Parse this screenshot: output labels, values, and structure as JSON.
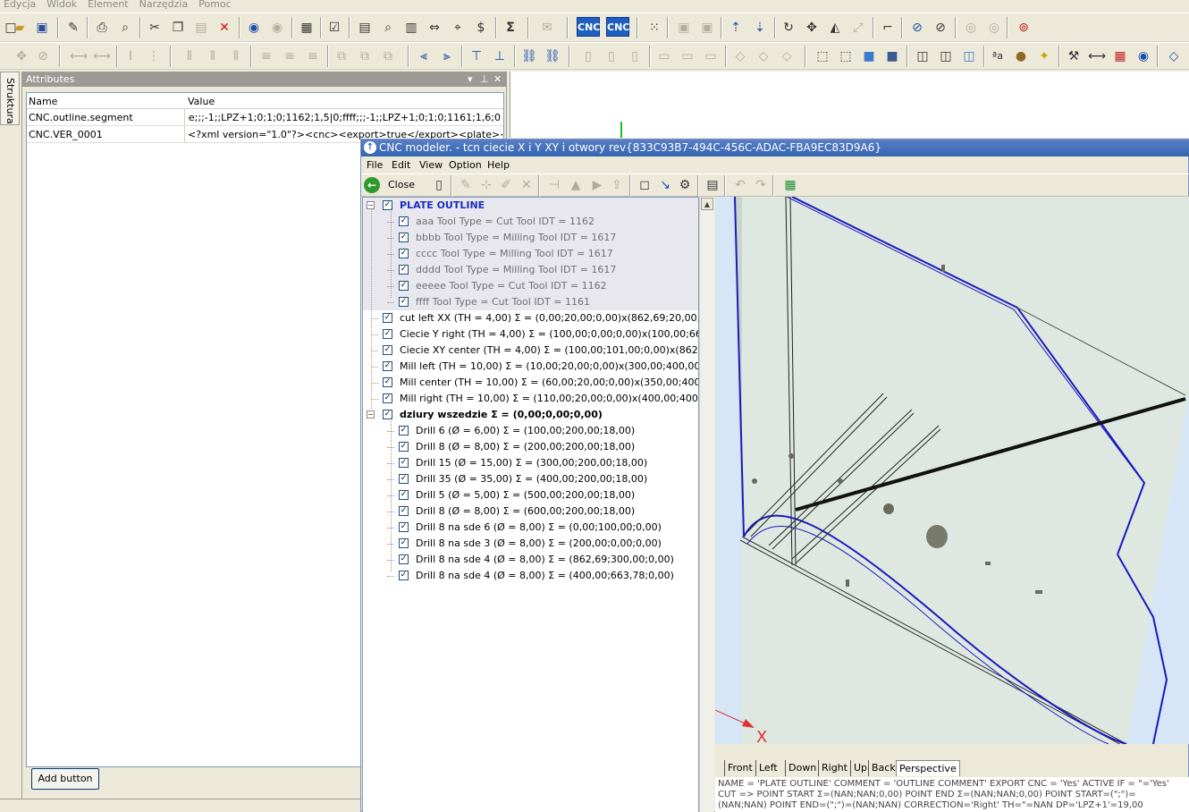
{
  "menu": [
    "Edycja",
    "Widok",
    "Element",
    "Narzędzia",
    "Pomoc"
  ],
  "toolbar": {
    "cnc1": "CNC",
    "cnc2": "CNC"
  },
  "sidetab": "Struktura",
  "attributes": {
    "title": "Attributes",
    "col_name": "Name",
    "col_value": "Value",
    "rows": [
      {
        "name": "CNC.outline.segment",
        "value": "0;eeeee;;;-1;;LPZ+1;0;1;0;1162;1,5|0;ffff;;;-1;;LPZ+1;0;1;0;1161;1,6|"
      },
      {
        "name": "CNC.VER_0001",
        "value": "<?xml version=\"1.0\"?><cnc><export>true</export><plate><width>86"
      }
    ],
    "add_button": "Add button"
  },
  "cnc": {
    "title": "CNC modeler. - tcn ciecie X i Y XY i otwory rev{833C93B7-494C-456C-ADAC-FBA9EC83D9A6}",
    "menu": [
      "File",
      "Edit",
      "View",
      "Option",
      "Help"
    ],
    "close": "Close",
    "tree": [
      {
        "label": "PLATE OUTLINE",
        "style": "blue",
        "level": 0,
        "exp": "−"
      },
      {
        "label": "aaa  Tool Type = Cut  Tool IDT = 1162",
        "style": "gray",
        "level": 1
      },
      {
        "label": "bbbb  Tool Type = Milling  Tool IDT = 1617",
        "style": "gray",
        "level": 1
      },
      {
        "label": "cccc  Tool Type = Milling  Tool IDT = 1617",
        "style": "gray",
        "level": 1
      },
      {
        "label": "dddd  Tool Type = Milling  Tool IDT = 1617",
        "style": "gray",
        "level": 1
      },
      {
        "label": "eeeee  Tool Type = Cut  Tool IDT = 1162",
        "style": "gray",
        "level": 1
      },
      {
        "label": "ffff  Tool Type = Cut  Tool IDT = 1161",
        "style": "gray",
        "level": 1
      },
      {
        "label": "cut left XX  (TH = 4,00)  Σ = (0,00;20,00;0,00)x(862,69;20,00;0,00)",
        "style": "",
        "level": 0
      },
      {
        "label": "Ciecie Y right  (TH = 4,00)  Σ = (100,00;0,00;0,00)x(100,00;663,78;0",
        "style": "",
        "level": 0
      },
      {
        "label": "Ciecie XY center  (TH = 4,00)  Σ = (100,00;101,00;0,00)x(862,69;66",
        "style": "",
        "level": 0
      },
      {
        "label": "Mill left  (TH = 10,00)  Σ = (10,00;20,00;0,00)x(300,00;400,00;0,00)",
        "style": "",
        "level": 0
      },
      {
        "label": "Mill center  (TH = 10,00)  Σ = (60,00;20,00;0,00)x(350,00;400,00;0,",
        "style": "",
        "level": 0
      },
      {
        "label": "Mill right  (TH = 10,00)  Σ = (110,00;20,00;0,00)x(400,00;400,00;0,0",
        "style": "",
        "level": 0
      },
      {
        "label": "dziury wszedzie Σ = (0,00;0,00;0,00)",
        "style": "bold",
        "level": 0,
        "exp": "−"
      },
      {
        "label": "Drill 6  (Ø = 6,00)  Σ = (100,00;200,00;18,00)",
        "style": "",
        "level": 1
      },
      {
        "label": "Drill 8  (Ø = 8,00)  Σ = (200,00;200,00;18,00)",
        "style": "",
        "level": 1
      },
      {
        "label": "Drill 15  (Ø = 15,00)  Σ = (300,00;200,00;18,00)",
        "style": "",
        "level": 1
      },
      {
        "label": "Drill 35  (Ø = 35,00)  Σ = (400,00;200,00;18,00)",
        "style": "",
        "level": 1
      },
      {
        "label": "Drill 5  (Ø = 5,00)  Σ = (500,00;200,00;18,00)",
        "style": "",
        "level": 1
      },
      {
        "label": "Drill 8  (Ø = 8,00)  Σ = (600,00;200,00;18,00)",
        "style": "",
        "level": 1
      },
      {
        "label": "Drill 8 na sde 6  (Ø = 8,00)  Σ = (0,00;100,00;0,00)",
        "style": "",
        "level": 1
      },
      {
        "label": "Drill 8 na sde 3  (Ø = 8,00)  Σ = (200,00;0,00;0,00)",
        "style": "",
        "level": 1
      },
      {
        "label": "Drill 8 na sde 4  (Ø = 8,00)  Σ = (862,69;300,00;0,00)",
        "style": "",
        "level": 1
      },
      {
        "label": "Drill 8 na sde 4  (Ø = 8,00)  Σ = (400,00;663,78;0,00)",
        "style": "",
        "level": 1
      }
    ],
    "view_tabs": [
      "Front",
      "Left",
      "Down",
      "Right",
      "Up",
      "Back",
      "Perspective"
    ],
    "axis_label": "X",
    "status": [
      "NAME = 'PLATE OUTLINE'   COMMENT = 'OUTLINE COMMENT'   EXPORT CNC = 'Yes'   ACTIVE IF = \"='Yes'",
      "CUT =>   POINT START Σ=(NAN;NAN;0,00)   POINT END Σ=(NAN;NAN;0,00)   POINT START=(\";\")=",
      "(NAN;NAN)   POINT END=(\";\")=(NAN;NAN)   CORRECTION='Right'   TH=\"=NAN   DP='LPZ+1'=19,00"
    ]
  }
}
